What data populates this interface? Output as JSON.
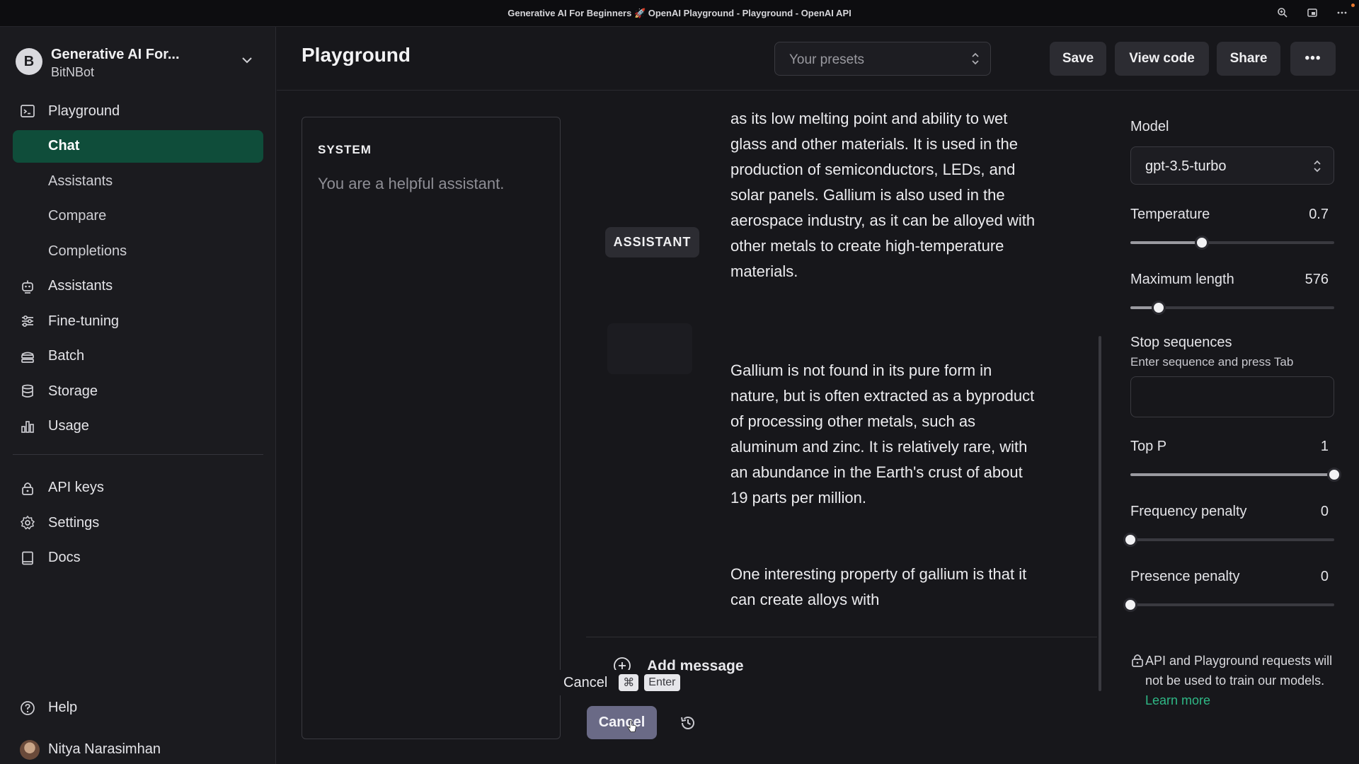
{
  "window": {
    "title": "Generative AI For Beginners 🚀 OpenAI Playground - Playground - OpenAI API"
  },
  "sidebar": {
    "org_initial": "B",
    "org_name": "Generative AI For...",
    "org_sub": "BitNBot",
    "items": [
      {
        "label": "Playground",
        "icon": "terminal-icon"
      },
      {
        "label": "Chat",
        "active": true
      },
      {
        "label": "Assistants"
      },
      {
        "label": "Compare"
      },
      {
        "label": "Completions"
      },
      {
        "label": "Assistants",
        "icon": "robot-icon"
      },
      {
        "label": "Fine-tuning",
        "icon": "sliders-icon"
      },
      {
        "label": "Batch",
        "icon": "batch-icon"
      },
      {
        "label": "Storage",
        "icon": "database-icon"
      },
      {
        "label": "Usage",
        "icon": "bar-chart-icon"
      }
    ],
    "lower_items": [
      {
        "label": "API keys",
        "icon": "lock-icon"
      },
      {
        "label": "Settings",
        "icon": "gear-icon"
      },
      {
        "label": "Docs",
        "icon": "book-icon"
      }
    ],
    "help": "Help",
    "user_name": "Nitya Narasimhan"
  },
  "header": {
    "title": "Playground",
    "presets_placeholder": "Your presets",
    "save": "Save",
    "view_code": "View code",
    "share": "Share",
    "more": "•••"
  },
  "system": {
    "label": "SYSTEM",
    "text": "You are a helpful assistant."
  },
  "chat": {
    "role": "ASSISTANT",
    "para1": "electronics, due to its unique properties such as its low melting point and ability to wet glass and other materials. It is used in the production of semiconductors, LEDs, and solar panels. Gallium is also used in the aerospace industry, as it can be alloyed with other metals to create high-temperature materials.",
    "para2": "Gallium is not found in its pure form in nature, but is often extracted as a byproduct of processing other metals, such as aluminum and zinc. It is relatively rare, with an abundance in the Earth's crust of about 19 parts per million.",
    "para3": "One interesting property of gallium is that it can create alloys with",
    "add_message": "Add message",
    "tooltip_cancel": "Cancel",
    "kbd_cmd": "⌘",
    "kbd_enter": "Enter",
    "cancel_button": "Cancel"
  },
  "settings": {
    "model_label": "Model",
    "model_value": "gpt-3.5-turbo",
    "temperature_label": "Temperature",
    "temperature_value": "0.7",
    "temperature_fraction": 0.35,
    "max_length_label": "Maximum length",
    "max_length_value": "576",
    "max_length_fraction": 0.14,
    "stop_label": "Stop sequences",
    "stop_help": "Enter sequence and press Tab",
    "top_p_label": "Top P",
    "top_p_value": "1",
    "top_p_fraction": 1.0,
    "freq_label": "Frequency penalty",
    "freq_value": "0",
    "freq_fraction": 0.0,
    "pres_label": "Presence penalty",
    "pres_value": "0",
    "pres_fraction": 0.0,
    "privacy_text": "API and Playground requests will not be used to train our models.",
    "privacy_link": "Learn more"
  },
  "colors": {
    "active_nav": "#0f4d3a",
    "link": "#2fb886",
    "cancel_button": "#6a6a86"
  }
}
